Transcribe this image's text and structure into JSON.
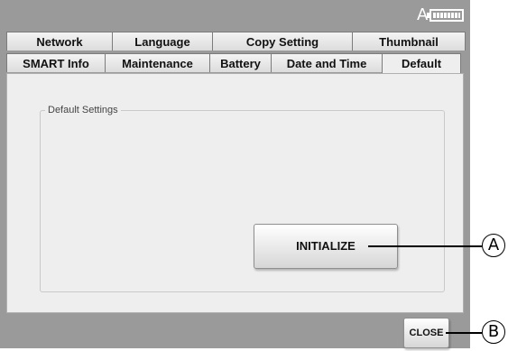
{
  "status": {
    "drive_letter": "A"
  },
  "tabs_row1": [
    "Network",
    "Language",
    "Copy Setting",
    "Thumbnail"
  ],
  "tabs_row2": [
    "SMART Info",
    "Maintenance",
    "Battery",
    "Date and Time",
    "Default"
  ],
  "active_tab": "Default",
  "panel": {
    "group_label": "Default Settings",
    "initialize_label": "INITIALIZE"
  },
  "footer": {
    "close_label": "CLOSE"
  },
  "callouts": {
    "a": "A",
    "b": "B"
  }
}
